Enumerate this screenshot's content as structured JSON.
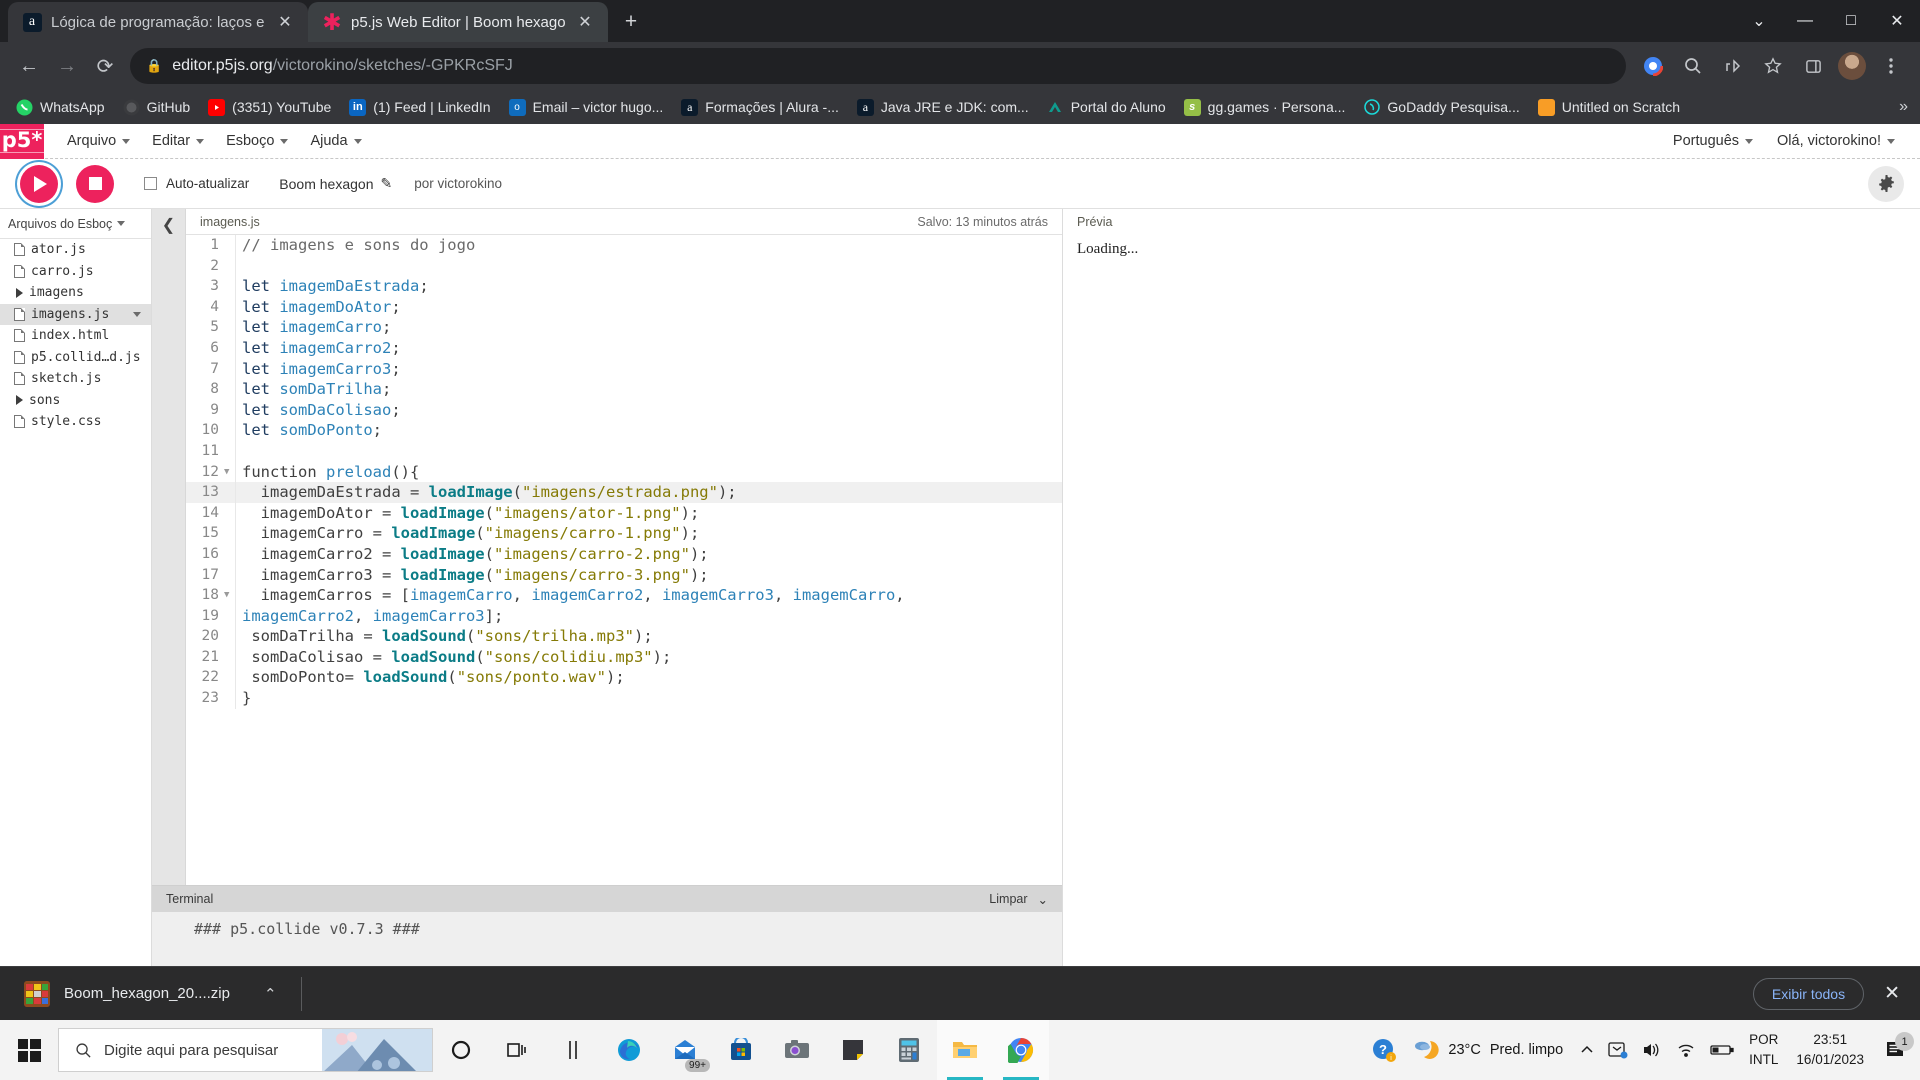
{
  "browser": {
    "tabs": [
      {
        "title": "Lógica de programação: laços e li",
        "favicon": "alura-icon",
        "active": false
      },
      {
        "title": "p5.js Web Editor | Boom hexagon",
        "favicon": "p5-asterisk-icon",
        "active": true
      }
    ],
    "new_tab_label": "+",
    "window_controls": {
      "minimize": "—",
      "maximize": "□",
      "close": "✕",
      "more": "⌄"
    },
    "omnibox": {
      "lock_icon": "lock-icon",
      "url_host": "editor.p5js.org",
      "url_path": "/victorokino/sketches/-GPKRcSFJ"
    },
    "nav": {
      "back": "←",
      "forward": "→",
      "reload": "⟳"
    },
    "bookmarks": [
      {
        "label": "WhatsApp",
        "icon": "whatsapp-icon"
      },
      {
        "label": "GitHub",
        "icon": "github-icon"
      },
      {
        "label": "(3351) YouTube",
        "icon": "youtube-icon"
      },
      {
        "label": "(1) Feed | LinkedIn",
        "icon": "linkedin-icon"
      },
      {
        "label": "Email – victor hugo...",
        "icon": "outlook-icon"
      },
      {
        "label": "Formações | Alura -...",
        "icon": "alura-icon"
      },
      {
        "label": "Java JRE e JDK: com...",
        "icon": "alura-icon"
      },
      {
        "label": "Portal do Aluno",
        "icon": "portal-icon"
      },
      {
        "label": "gg.games · Persona...",
        "icon": "shopify-icon"
      },
      {
        "label": "GoDaddy Pesquisa...",
        "icon": "godaddy-icon"
      },
      {
        "label": "Untitled on Scratch",
        "icon": "scratch-icon"
      }
    ],
    "bookmarks_overflow": "»"
  },
  "p5editor": {
    "logo": "p5*",
    "menu": [
      "Arquivo",
      "Editar",
      "Esboço",
      "Ajuda"
    ],
    "language": "Português",
    "account": "Olá, victorokino!",
    "toolbar": {
      "play_label": "play-button",
      "stop_label": "stop-button",
      "autorefresh": "Auto-atualizar",
      "sketch_name": "Boom hexagon",
      "author": "por victorokino",
      "settings": "gear-icon"
    },
    "files_panel": {
      "header": "Arquivos do Esboç",
      "items": [
        {
          "name": "ator.js",
          "type": "file",
          "selected": false
        },
        {
          "name": "carro.js",
          "type": "file",
          "selected": false
        },
        {
          "name": "imagens",
          "type": "folder",
          "selected": false
        },
        {
          "name": "imagens.js",
          "type": "file",
          "selected": true
        },
        {
          "name": "index.html",
          "type": "file",
          "selected": false
        },
        {
          "name": "p5.collid…d.js",
          "type": "file",
          "selected": false
        },
        {
          "name": "sketch.js",
          "type": "file",
          "selected": false
        },
        {
          "name": "sons",
          "type": "folder",
          "selected": false
        },
        {
          "name": "style.css",
          "type": "file",
          "selected": false
        }
      ]
    },
    "editor_header": {
      "filename": "imagens.js",
      "saved_status": "Salvo: 13 minutos atrás"
    },
    "code_lines": [
      {
        "n": "1",
        "fold": false,
        "hl": false,
        "tokens": [
          [
            "com",
            "// imagens e sons do jogo"
          ]
        ]
      },
      {
        "n": "2",
        "fold": false,
        "hl": false,
        "tokens": [
          [
            "pun",
            ""
          ]
        ]
      },
      {
        "n": "3",
        "fold": false,
        "hl": false,
        "tokens": [
          [
            "let",
            "let "
          ],
          [
            "var",
            "imagemDaEstrada"
          ],
          [
            "pun",
            ";"
          ]
        ]
      },
      {
        "n": "4",
        "fold": false,
        "hl": false,
        "tokens": [
          [
            "let",
            "let "
          ],
          [
            "var",
            "imagemDoAtor"
          ],
          [
            "pun",
            ";"
          ]
        ]
      },
      {
        "n": "5",
        "fold": false,
        "hl": false,
        "tokens": [
          [
            "let",
            "let "
          ],
          [
            "var",
            "imagemCarro"
          ],
          [
            "pun",
            ";"
          ]
        ]
      },
      {
        "n": "6",
        "fold": false,
        "hl": false,
        "tokens": [
          [
            "let",
            "let "
          ],
          [
            "var",
            "imagemCarro2"
          ],
          [
            "pun",
            ";"
          ]
        ]
      },
      {
        "n": "7",
        "fold": false,
        "hl": false,
        "tokens": [
          [
            "let",
            "let "
          ],
          [
            "var",
            "imagemCarro3"
          ],
          [
            "pun",
            ";"
          ]
        ]
      },
      {
        "n": "8",
        "fold": false,
        "hl": false,
        "tokens": [
          [
            "let",
            "let "
          ],
          [
            "var",
            "somDaTrilha"
          ],
          [
            "pun",
            ";"
          ]
        ]
      },
      {
        "n": "9",
        "fold": false,
        "hl": false,
        "tokens": [
          [
            "let",
            "let "
          ],
          [
            "var",
            "somDaColisao"
          ],
          [
            "pun",
            ";"
          ]
        ]
      },
      {
        "n": "10",
        "fold": false,
        "hl": false,
        "tokens": [
          [
            "let",
            "let "
          ],
          [
            "var",
            "somDoPonto"
          ],
          [
            "pun",
            ";"
          ]
        ]
      },
      {
        "n": "11",
        "fold": false,
        "hl": false,
        "tokens": [
          [
            "pun",
            ""
          ]
        ]
      },
      {
        "n": "12",
        "fold": true,
        "hl": false,
        "tokens": [
          [
            "fn",
            "function "
          ],
          [
            "var",
            "preload"
          ],
          [
            "pun",
            "(){"
          ]
        ]
      },
      {
        "n": "13",
        "fold": false,
        "hl": true,
        "tokens": [
          [
            "pun",
            "  "
          ],
          [
            "fn",
            "imagemDaEstrada"
          ],
          [
            "pun",
            " = "
          ],
          [
            "call",
            "loadImage"
          ],
          [
            "pun",
            "("
          ],
          [
            "str",
            "\"imagens/estrada.png\""
          ],
          [
            "pun",
            ");"
          ]
        ]
      },
      {
        "n": "14",
        "fold": false,
        "hl": false,
        "tokens": [
          [
            "pun",
            "  "
          ],
          [
            "fn",
            "imagemDoAtor"
          ],
          [
            "pun",
            " = "
          ],
          [
            "call",
            "loadImage"
          ],
          [
            "pun",
            "("
          ],
          [
            "str",
            "\"imagens/ator-1.png\""
          ],
          [
            "pun",
            ");"
          ]
        ]
      },
      {
        "n": "15",
        "fold": false,
        "hl": false,
        "tokens": [
          [
            "pun",
            "  "
          ],
          [
            "fn",
            "imagemCarro"
          ],
          [
            "pun",
            " = "
          ],
          [
            "call",
            "loadImage"
          ],
          [
            "pun",
            "("
          ],
          [
            "str",
            "\"imagens/carro-1.png\""
          ],
          [
            "pun",
            ");"
          ]
        ]
      },
      {
        "n": "16",
        "fold": false,
        "hl": false,
        "tokens": [
          [
            "pun",
            "  "
          ],
          [
            "fn",
            "imagemCarro2"
          ],
          [
            "pun",
            " = "
          ],
          [
            "call",
            "loadImage"
          ],
          [
            "pun",
            "("
          ],
          [
            "str",
            "\"imagens/carro-2.png\""
          ],
          [
            "pun",
            ");"
          ]
        ]
      },
      {
        "n": "17",
        "fold": false,
        "hl": false,
        "tokens": [
          [
            "pun",
            "  "
          ],
          [
            "fn",
            "imagemCarro3"
          ],
          [
            "pun",
            " = "
          ],
          [
            "call",
            "loadImage"
          ],
          [
            "pun",
            "("
          ],
          [
            "str",
            "\"imagens/carro-3.png\""
          ],
          [
            "pun",
            ");"
          ]
        ]
      },
      {
        "n": "18",
        "fold": true,
        "hl": false,
        "tokens": [
          [
            "pun",
            "  "
          ],
          [
            "fn",
            "imagemCarros"
          ],
          [
            "pun",
            " = ["
          ],
          [
            "var",
            "imagemCarro"
          ],
          [
            "pun",
            ", "
          ],
          [
            "var",
            "imagemCarro2"
          ],
          [
            "pun",
            ", "
          ],
          [
            "var",
            "imagemCarro3"
          ],
          [
            "pun",
            ", "
          ],
          [
            "var",
            "imagemCarro"
          ],
          [
            "pun",
            ","
          ]
        ]
      },
      {
        "n": "19",
        "fold": false,
        "hl": false,
        "tokens": [
          [
            "var",
            "imagemCarro2"
          ],
          [
            "pun",
            ", "
          ],
          [
            "var",
            "imagemCarro3"
          ],
          [
            "pun",
            "];"
          ]
        ]
      },
      {
        "n": "20",
        "fold": false,
        "hl": false,
        "tokens": [
          [
            "pun",
            " "
          ],
          [
            "fn",
            "somDaTrilha"
          ],
          [
            "pun",
            " = "
          ],
          [
            "call",
            "loadSound"
          ],
          [
            "pun",
            "("
          ],
          [
            "str",
            "\"sons/trilha.mp3\""
          ],
          [
            "pun",
            ");"
          ]
        ]
      },
      {
        "n": "21",
        "fold": false,
        "hl": false,
        "tokens": [
          [
            "pun",
            " "
          ],
          [
            "fn",
            "somDaColisao"
          ],
          [
            "pun",
            " = "
          ],
          [
            "call",
            "loadSound"
          ],
          [
            "pun",
            "("
          ],
          [
            "str",
            "\"sons/colidiu.mp3\""
          ],
          [
            "pun",
            ");"
          ]
        ]
      },
      {
        "n": "22",
        "fold": false,
        "hl": false,
        "tokens": [
          [
            "pun",
            " "
          ],
          [
            "fn",
            "somDoPonto"
          ],
          [
            "pun",
            "= "
          ],
          [
            "call",
            "loadSound"
          ],
          [
            "pun",
            "("
          ],
          [
            "str",
            "\"sons/ponto.wav\""
          ],
          [
            "pun",
            ");"
          ]
        ]
      },
      {
        "n": "23",
        "fold": false,
        "hl": false,
        "tokens": [
          [
            "pun",
            "}"
          ]
        ]
      }
    ],
    "terminal": {
      "title": "Terminal",
      "clear_label": "Limpar",
      "output": "### p5.collide v0.7.3 ###",
      "prompt": ">"
    },
    "preview": {
      "title": "Prévia",
      "content": "Loading..."
    }
  },
  "download_bar": {
    "filename": "Boom_hexagon_20....zip",
    "file_icon": "winrar-zip-icon",
    "caret": "⌃",
    "show_all": "Exibir todos",
    "close": "✕"
  },
  "taskbar": {
    "start": "windows-start-icon",
    "search_placeholder": "Digite aqui para pesquisar",
    "icons": [
      {
        "name": "cortana-icon",
        "active": false
      },
      {
        "name": "task-view-icon",
        "active": false
      },
      {
        "name": "widgets-icon",
        "active": false
      },
      {
        "name": "microsoft-edge-icon",
        "active": false
      },
      {
        "name": "mail-icon",
        "badge": "99+",
        "active": false
      },
      {
        "name": "microsoft-store-icon",
        "active": false
      },
      {
        "name": "camera-icon",
        "active": false
      },
      {
        "name": "sticky-notes-icon",
        "active": false
      },
      {
        "name": "calculator-icon",
        "active": false
      },
      {
        "name": "file-explorer-icon",
        "active": true
      },
      {
        "name": "google-chrome-icon",
        "active": true
      }
    ],
    "tray": {
      "help_icon": "help-icon",
      "weather_temp": "23°C",
      "weather_desc": "Pred. limpo",
      "overflow": "⌃",
      "onedrive": "onedrive-icon",
      "volume": "volume-icon",
      "network": "network-icon",
      "battery": "battery-icon",
      "lang_line1": "POR",
      "lang_line2": "INTL",
      "time": "23:51",
      "date": "16/01/2023",
      "notification_count": "1"
    }
  },
  "colors": {
    "p5_pink": "#ed225d",
    "chrome_dark": "#202124",
    "accent_blue": "#8ab4f8",
    "terminal_bg": "#efefef"
  }
}
